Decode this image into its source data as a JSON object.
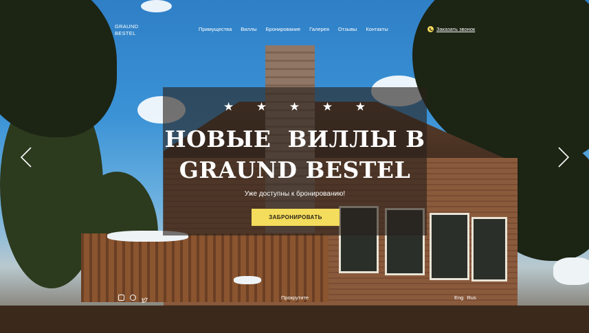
{
  "brand": {
    "line1": "GRAUND",
    "line2": "BESTEL"
  },
  "nav": {
    "items": [
      {
        "label": "Примущества"
      },
      {
        "label": "Виллы"
      },
      {
        "label": "Бронирование"
      },
      {
        "label": "Галерея"
      },
      {
        "label": "Отзывы"
      },
      {
        "label": "Контакты"
      }
    ]
  },
  "header": {
    "callback_label": "Заказать звонок",
    "callback_icon": "phone-icon"
  },
  "hero": {
    "stars": "★ ★ ★ ★ ★",
    "rating": 5,
    "title_line1": "НОВЫЕ  ВИЛЛЫ В",
    "title_line2": "GRAUND BESTEL",
    "subtitle": "Уже доступны к бронированию!",
    "button_label": "ЗАБРОНИРОВАТЬ"
  },
  "slider": {
    "prev_icon": "chevron-left-icon",
    "next_icon": "chevron-right-icon"
  },
  "footer": {
    "social_icons": [
      "instagram-icon",
      "pinterest-icon",
      "twitter-icon"
    ],
    "scroll_hint": "Прокрутите",
    "languages": [
      {
        "label": "Eng"
      },
      {
        "label": "Rus"
      }
    ]
  },
  "colors": {
    "accent": "#f4dc5c",
    "overlay": "#28201c",
    "text": "#ffffff"
  }
}
